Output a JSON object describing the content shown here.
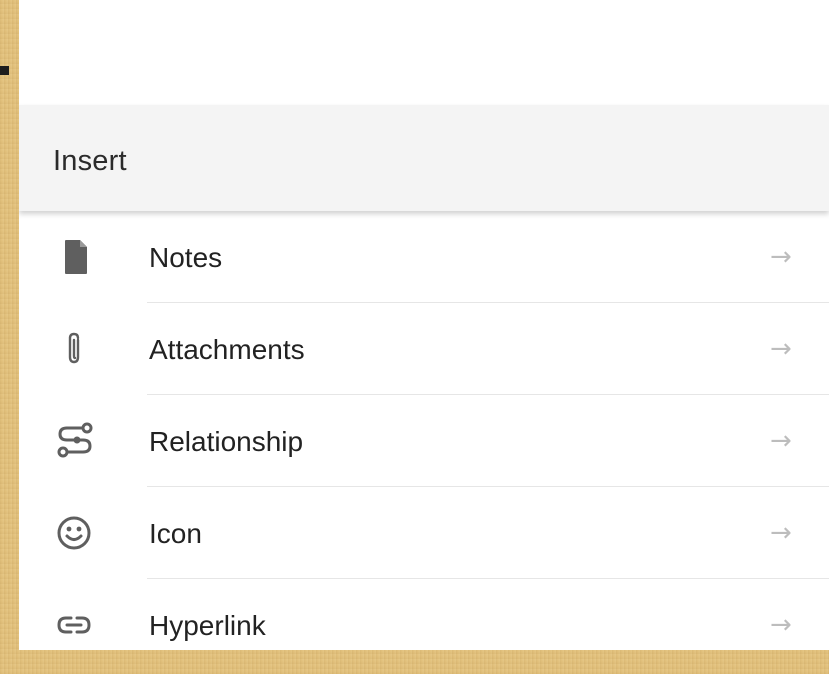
{
  "menu": {
    "title": "Insert",
    "items": [
      {
        "label": "Notes",
        "icon": "note-icon",
        "arrow": "→"
      },
      {
        "label": "Attachments",
        "icon": "paperclip-icon",
        "arrow": "→"
      },
      {
        "label": "Relationship",
        "icon": "relationship-icon",
        "arrow": "→"
      },
      {
        "label": "Icon",
        "icon": "smiley-icon",
        "arrow": "→"
      },
      {
        "label": "Hyperlink",
        "icon": "link-icon",
        "arrow": "→"
      }
    ]
  },
  "colors": {
    "background": "#e3c27d",
    "panel": "#ffffff",
    "header": "#f4f4f4",
    "icon": "#5f5f5f",
    "arrow": "#bdbdbd",
    "text": "#222222"
  }
}
